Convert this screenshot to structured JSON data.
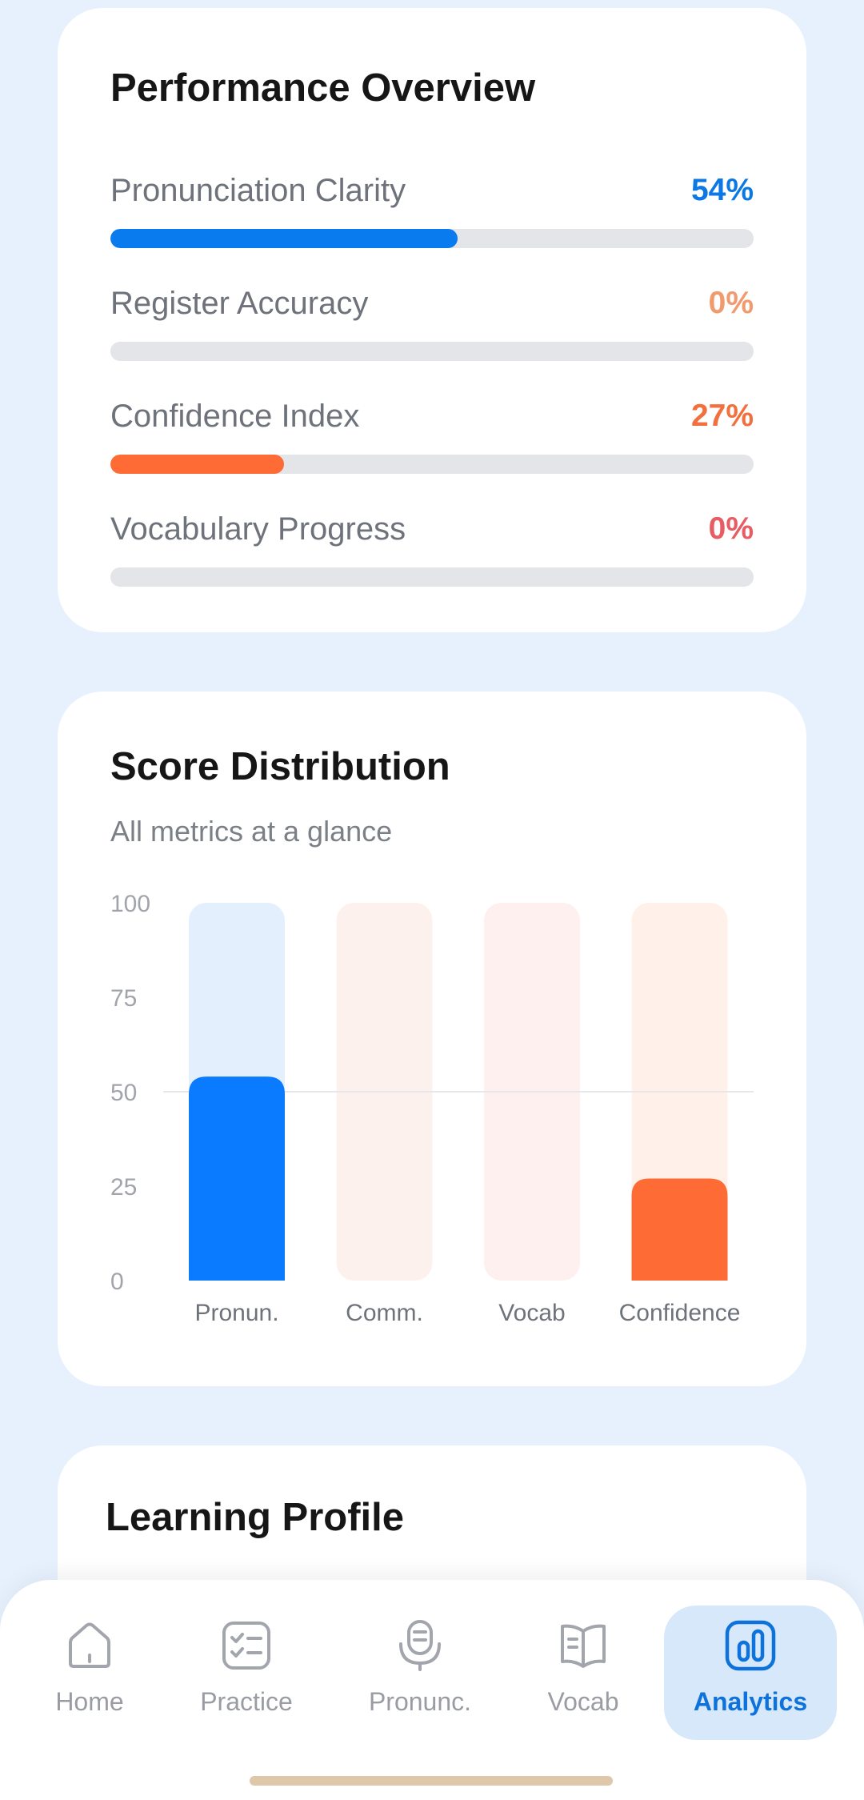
{
  "performance": {
    "title": "Performance Overview",
    "metrics": [
      {
        "label": "Pronunciation Clarity",
        "value_text": "54%",
        "value": 54,
        "color": "#0a7bef",
        "value_color": "#0b78e6"
      },
      {
        "label": "Register Accuracy",
        "value_text": "0%",
        "value": 0,
        "color": "#f19a6e",
        "value_color": "#f19a6e"
      },
      {
        "label": "Confidence Index",
        "value_text": "27%",
        "value": 27,
        "color": "#ff6b35",
        "value_color": "#f2703d"
      },
      {
        "label": "Vocabulary Progress",
        "value_text": "0%",
        "value": 0,
        "color": "#e85c63",
        "value_color": "#e85c63"
      }
    ]
  },
  "distribution": {
    "title": "Score Distribution",
    "subtitle": "All metrics at a glance"
  },
  "chart_data": {
    "type": "bar",
    "categories": [
      "Pronun.",
      "Comm.",
      "Vocab",
      "Confidence"
    ],
    "values": [
      54,
      0,
      0,
      27
    ],
    "ylim": [
      0,
      100
    ],
    "yticks": [
      "100",
      "75",
      "50",
      "25",
      "0"
    ],
    "reference_line": 50,
    "bar_colors": [
      "#0a7bff",
      "#f7a98a",
      "#f4a0a4",
      "#ff6b35"
    ],
    "track_colors": [
      "#e3effc",
      "#fdf1ee",
      "#fdf0ef",
      "#fff0e9"
    ]
  },
  "profile": {
    "title": "Learning Profile"
  },
  "nav": {
    "items": [
      {
        "label": "Home",
        "icon": "home-icon",
        "active": false
      },
      {
        "label": "Practice",
        "icon": "checklist-icon",
        "active": false
      },
      {
        "label": "Pronunc.",
        "icon": "microphone-icon",
        "active": false
      },
      {
        "label": "Vocab",
        "icon": "book-icon",
        "active": false
      },
      {
        "label": "Analytics",
        "icon": "bar-chart-icon",
        "active": true
      }
    ]
  }
}
